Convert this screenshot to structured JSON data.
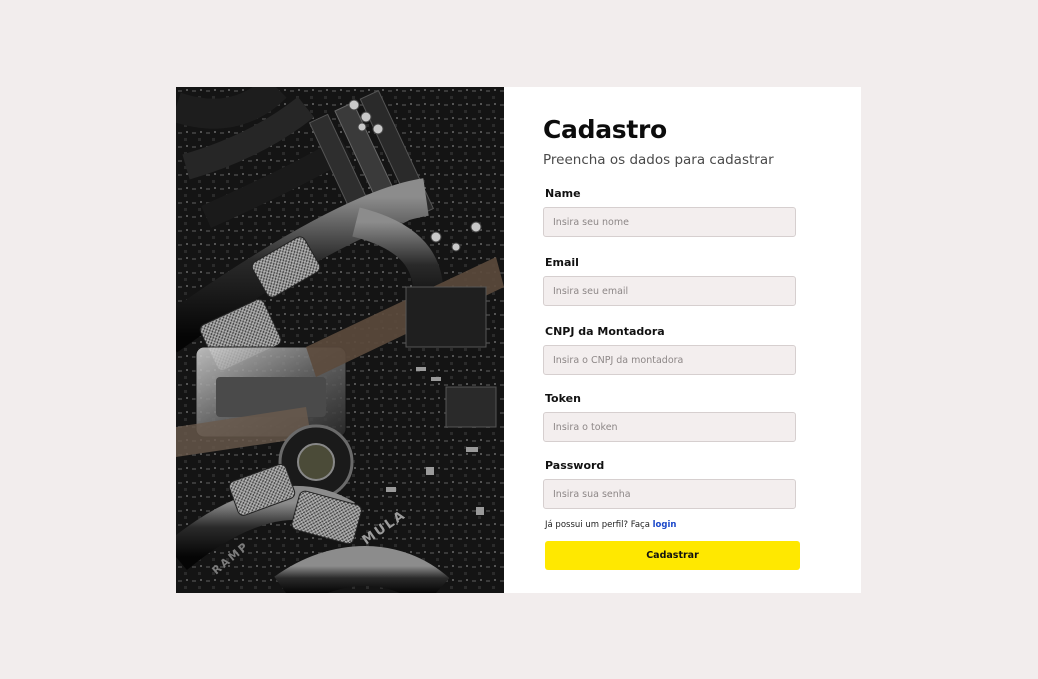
{
  "form": {
    "title": "Cadastro",
    "subtitle": "Preencha os dados para cadastrar",
    "fields": [
      {
        "label": "Name",
        "placeholder": "Insira seu nome"
      },
      {
        "label": "Email",
        "placeholder": "Insira seu email"
      },
      {
        "label": "CNPJ da Montadora",
        "placeholder": "Insira o CNPJ da montadora"
      },
      {
        "label": "Token",
        "placeholder": "Insira o token"
      },
      {
        "label": "Password",
        "placeholder": "Insira sua senha"
      }
    ],
    "login_prompt": "Já possui um perfil? Faça ",
    "login_link": "login",
    "submit_label": "Cadastrar"
  },
  "colors": {
    "page_background": "#f2eded",
    "card_background": "#ffffff",
    "input_background": "#f3eeee",
    "button_background": "#ffe800",
    "link": "#1a47c9"
  },
  "hero": {
    "icon": "motherboard-photo",
    "text_on_image": [
      "MULA",
      "RAMP"
    ]
  }
}
